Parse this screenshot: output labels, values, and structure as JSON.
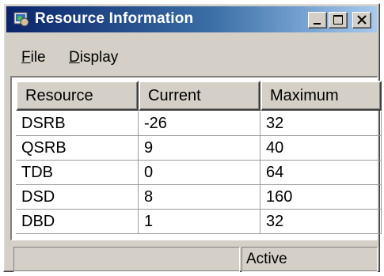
{
  "window": {
    "title": "Resource Information",
    "controls": {
      "minimize_icon": "minimize-icon",
      "maximize_icon": "maximize-icon",
      "close_icon": "close-icon"
    },
    "title_gradient": [
      "#0a246a",
      "#a6caf0"
    ],
    "face_color": "#d4d0c8"
  },
  "menu": {
    "items": [
      {
        "mnemonic": "F",
        "rest": "ile"
      },
      {
        "mnemonic": "D",
        "rest": "isplay"
      }
    ]
  },
  "table": {
    "headers": [
      "Resource",
      "Current",
      "Maximum"
    ],
    "rows": [
      [
        "DSRB",
        "-26",
        "32"
      ],
      [
        "QSRB",
        "9",
        "40"
      ],
      [
        "TDB",
        "0",
        "64"
      ],
      [
        "DSD",
        "8",
        "160"
      ],
      [
        "DBD",
        "1",
        "32"
      ]
    ]
  },
  "statusbar": {
    "left": "",
    "right": "Active"
  }
}
